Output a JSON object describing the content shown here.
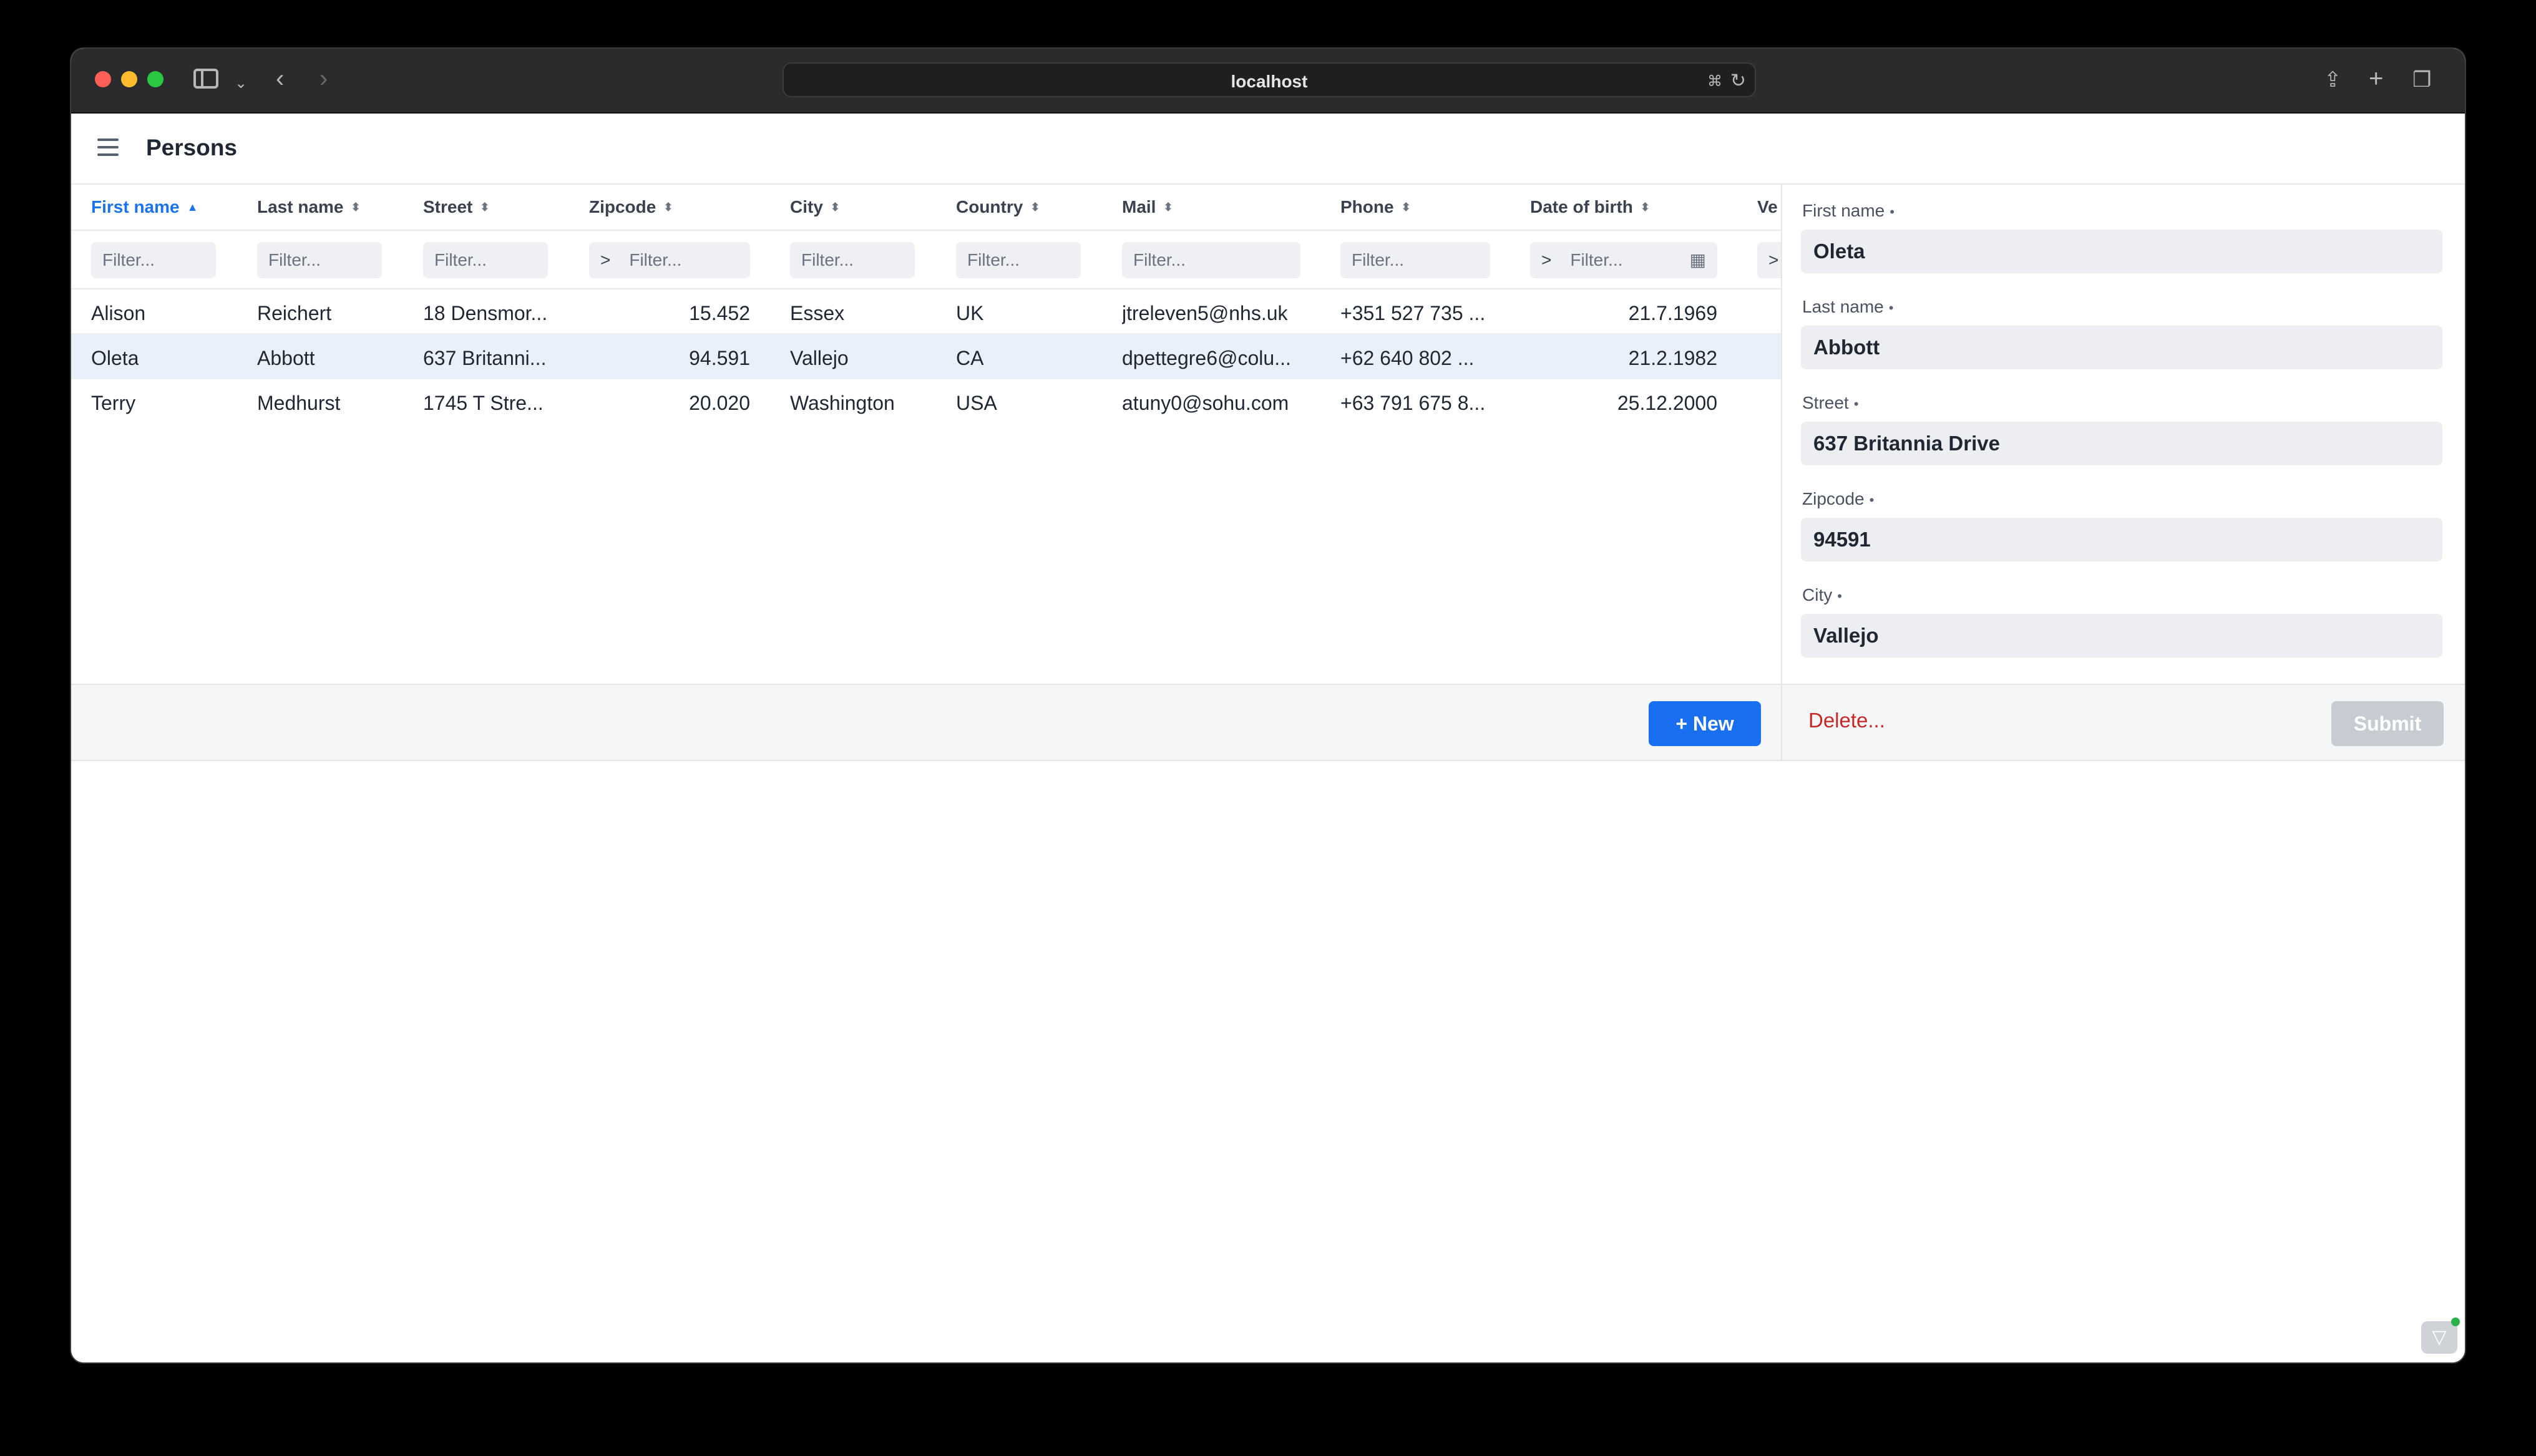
{
  "browser": {
    "url": "localhost"
  },
  "app": {
    "title": "Persons"
  },
  "grid": {
    "columns": [
      {
        "label": "First name"
      },
      {
        "label": "Last name"
      },
      {
        "label": "Street"
      },
      {
        "label": "Zipcode"
      },
      {
        "label": "City"
      },
      {
        "label": "Country"
      },
      {
        "label": "Mail"
      },
      {
        "label": "Phone"
      },
      {
        "label": "Date of birth"
      },
      {
        "label": "Ve"
      }
    ],
    "filter_placeholder": "Filter...",
    "filter_operator": ">",
    "rows": [
      {
        "first": "Alison",
        "last": "Reichert",
        "street": "18 Densmor...",
        "zip": "15.452",
        "city": "Essex",
        "country": "UK",
        "mail": "jtreleven5@nhs.uk",
        "phone": "+351 527 735 ...",
        "dob": "21.7.1969"
      },
      {
        "first": "Oleta",
        "last": "Abbott",
        "street": "637 Britanni...",
        "zip": "94.591",
        "city": "Vallejo",
        "country": "CA",
        "mail": "dpettegre6@colu...",
        "phone": "+62 640 802 ...",
        "dob": "21.2.1982"
      },
      {
        "first": "Terry",
        "last": "Medhurst",
        "street": "1745 T Stre...",
        "zip": "20.020",
        "city": "Washington",
        "country": "USA",
        "mail": "atuny0@sohu.com",
        "phone": "+63 791 675 8...",
        "dob": "25.12.2000"
      }
    ],
    "new_button": "+ New"
  },
  "editor": {
    "fields": [
      {
        "label": "First name",
        "value": "Oleta"
      },
      {
        "label": "Last name",
        "value": "Abbott"
      },
      {
        "label": "Street",
        "value": "637 Britannia Drive"
      },
      {
        "label": "Zipcode",
        "value": "94591"
      },
      {
        "label": "City",
        "value": "Vallejo"
      }
    ],
    "required_marker": "•",
    "delete_button": "Delete...",
    "submit_button": "Submit"
  },
  "icons": {
    "sort": "⬍",
    "sort_asc": "▲",
    "calendar": "▦"
  }
}
